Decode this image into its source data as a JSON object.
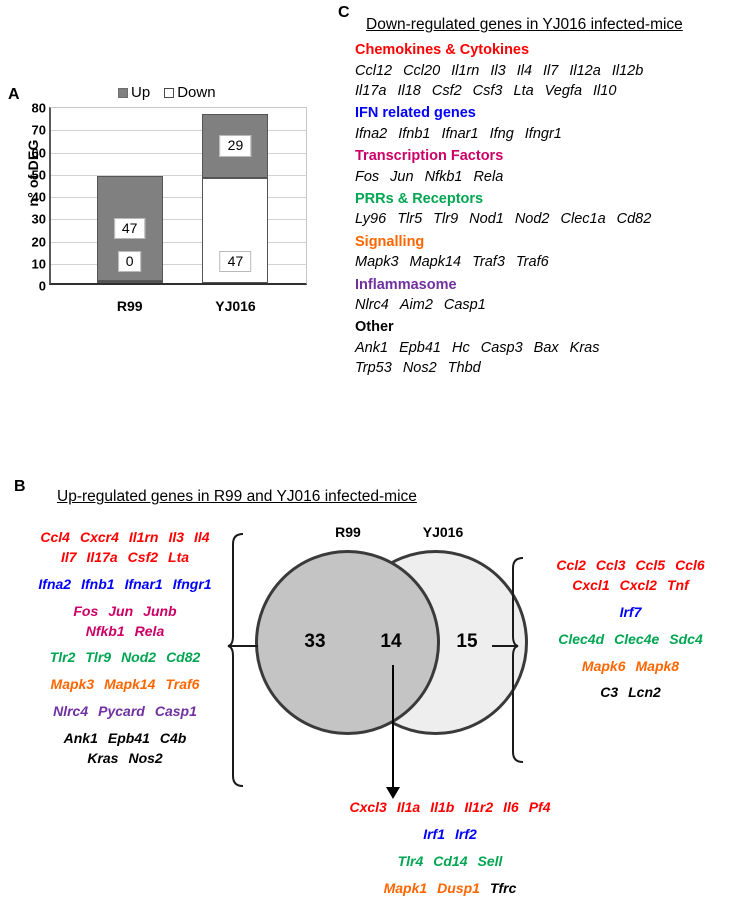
{
  "panels": {
    "a_letter": "A",
    "b_letter": "B",
    "c_letter": "C"
  },
  "panel_a": {
    "ylabel": "n° of DEG",
    "legend": [
      {
        "label": "Up",
        "swatch": "filled-gray-square-icon",
        "color": "#808080"
      },
      {
        "label": "Down",
        "swatch": "empty-white-square-icon",
        "color": "#ffffff"
      }
    ]
  },
  "chart_data": {
    "type": "bar",
    "title": "",
    "xlabel": "",
    "ylabel": "n° of DEG",
    "ylim": [
      0,
      80
    ],
    "yticks": [
      0,
      10,
      20,
      30,
      40,
      50,
      60,
      70,
      80
    ],
    "categories": [
      "R99",
      "YJ016"
    ],
    "stacked": true,
    "grid": true,
    "legend_position": "top",
    "series": [
      {
        "name": "Down",
        "color": "#ffffff",
        "values": [
          0,
          47
        ]
      },
      {
        "name": "Up",
        "color": "#808080",
        "values": [
          47,
          29
        ]
      }
    ],
    "bar_totals": [
      47,
      76
    ],
    "data_labels": [
      {
        "category": "R99",
        "series": "Up",
        "value": 47
      },
      {
        "category": "R99",
        "series": "Down",
        "value": 0
      },
      {
        "category": "YJ016",
        "series": "Up",
        "value": 29
      },
      {
        "category": "YJ016",
        "series": "Down",
        "value": 47
      }
    ]
  },
  "panel_c": {
    "title": "Down-regulated genes in YJ016 infected-mice",
    "categories": [
      {
        "name": "Chemokines & Cytokines",
        "color": "#ff0000",
        "gene_rows": [
          [
            "Ccl12",
            "Ccl20",
            "Il1rn",
            "Il3",
            "Il4",
            "Il7",
            "Il12a",
            "Il12b"
          ],
          [
            "Il17a",
            "Il18",
            "Csf2",
            "Csf3",
            "Lta",
            "Vegfa",
            "Il10"
          ]
        ]
      },
      {
        "name": "IFN related genes",
        "color": "#0000ff",
        "gene_rows": [
          [
            "Ifna2",
            "Ifnb1",
            "Ifnar1",
            "Ifng",
            "Ifngr1"
          ]
        ]
      },
      {
        "name": "Transcription Factors",
        "color": "#cc0066",
        "gene_rows": [
          [
            "Fos",
            "Jun",
            "Nfkb1",
            "Rela"
          ]
        ]
      },
      {
        "name": "PRRs & Receptors",
        "color": "#00a651",
        "gene_rows": [
          [
            "Ly96",
            "Tlr5",
            "Tlr9",
            "Nod1",
            "Nod2",
            "Clec1a",
            "Cd82"
          ]
        ]
      },
      {
        "name": "Signalling",
        "color": "#ff6600",
        "gene_rows": [
          [
            "Mapk3",
            "Mapk14",
            "Traf3",
            "Traf6"
          ]
        ]
      },
      {
        "name": "Inflammasome",
        "color": "#7030a0",
        "gene_rows": [
          [
            "Nlrc4",
            "Aim2",
            "Casp1"
          ]
        ]
      },
      {
        "name": "Other",
        "color": "#000000",
        "gene_rows": [
          [
            "Ank1",
            "Epb41",
            "Hc",
            "Casp3",
            "Bax",
            "Kras"
          ],
          [
            "Trp53",
            "Nos2",
            "Thbd"
          ]
        ]
      }
    ]
  },
  "panel_b": {
    "title": "Up-regulated genes in R99 and YJ016 infected-mice",
    "venn": {
      "left_label": "R99",
      "right_label": "YJ016",
      "left_count": "33",
      "intersection_count": "14",
      "right_count": "15",
      "left_fill": "#c4c4c4",
      "right_fill": "#eeeeee"
    },
    "left_genes": [
      {
        "color": "#ff0000",
        "rows": [
          [
            "Ccl4",
            "Cxcr4",
            "Il1rn",
            "Il3",
            "Il4"
          ],
          [
            "Il7",
            "Il17a",
            "Csf2",
            "Lta"
          ]
        ]
      },
      {
        "color": "#0000ff",
        "rows": [
          [
            "Ifna2",
            "Ifnb1",
            "Ifnar1",
            "Ifngr1"
          ]
        ]
      },
      {
        "color": "#cc0066",
        "rows": [
          [
            "Fos",
            "Jun",
            "Junb"
          ],
          [
            "Nfkb1",
            "Rela"
          ]
        ]
      },
      {
        "color": "#00a651",
        "rows": [
          [
            "Tlr2",
            "Tlr9",
            "Nod2",
            "Cd82"
          ]
        ]
      },
      {
        "color": "#ff6600",
        "rows": [
          [
            "Mapk3",
            "Mapk14",
            "Traf6"
          ]
        ]
      },
      {
        "color": "#7030a0",
        "rows": [
          [
            "Nlrc4",
            "Pycard",
            "Casp1"
          ]
        ]
      },
      {
        "color": "#000000",
        "rows": [
          [
            "Ank1",
            "Epb41",
            "C4b"
          ],
          [
            "Kras",
            "Nos2"
          ]
        ]
      }
    ],
    "right_genes": [
      {
        "color": "#ff0000",
        "rows": [
          [
            "Ccl2",
            "Ccl3",
            "Ccl5",
            "Ccl6"
          ],
          [
            "Cxcl1",
            "Cxcl2",
            "Tnf"
          ]
        ]
      },
      {
        "color": "#0000ff",
        "rows": [
          [
            "Irf7"
          ]
        ]
      },
      {
        "color": "#00a651",
        "rows": [
          [
            "Clec4d",
            "Clec4e",
            "Sdc4"
          ]
        ]
      },
      {
        "color": "#ff6600",
        "rows": [
          [
            "Mapk6",
            "Mapk8"
          ]
        ]
      },
      {
        "color": "#000000",
        "rows": [
          [
            "C3",
            "Lcn2"
          ]
        ]
      }
    ],
    "shared_genes": [
      {
        "color": "#ff0000",
        "rows": [
          [
            "Cxcl3",
            "Il1a",
            "Il1b",
            "Il1r2",
            "Il6",
            "Pf4"
          ]
        ]
      },
      {
        "color": "#0000ff",
        "rows": [
          [
            "Irf1",
            "Irf2"
          ]
        ]
      },
      {
        "color": "#00a651",
        "rows": [
          [
            "Tlr4",
            "Cd14",
            "Sell"
          ]
        ]
      },
      {
        "color": "#ff6600",
        "rows": [
          [
            "Mapk1",
            "Dusp1"
          ]
        ],
        "trailing": {
          "text": "Tfrc",
          "color": "#000000"
        }
      }
    ]
  }
}
